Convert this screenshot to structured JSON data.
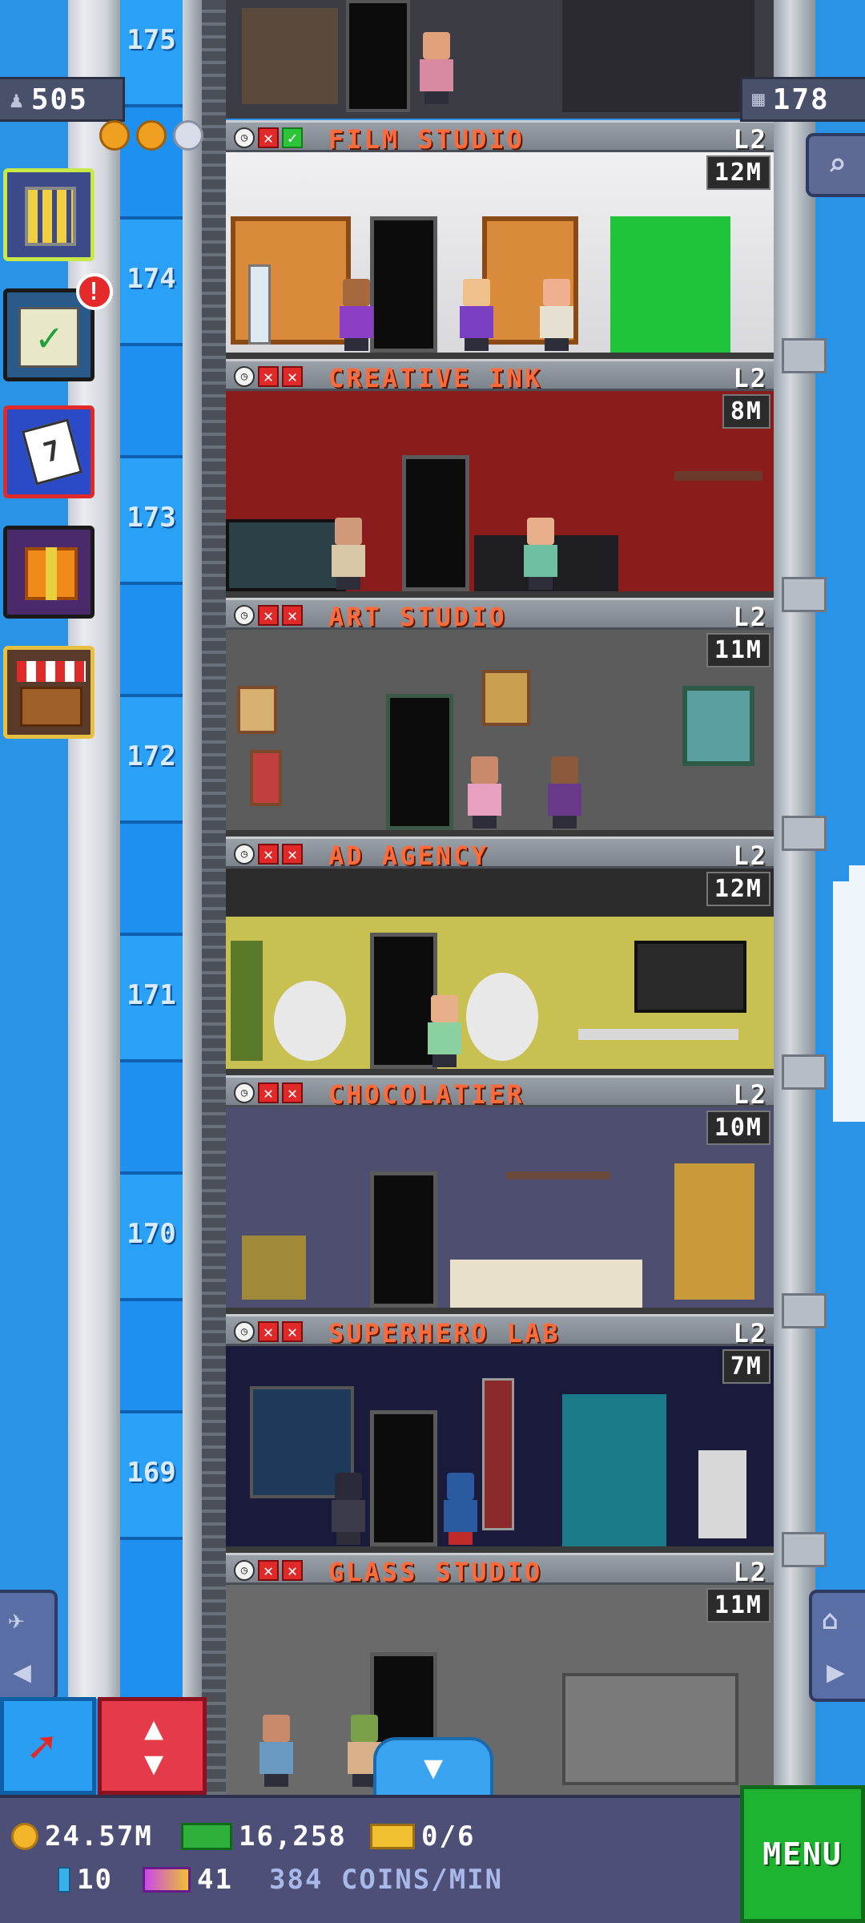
{
  "top": {
    "population": "505",
    "floor_count": "178",
    "top_floor_number": "175"
  },
  "shaft": {
    "floor_numbers": [
      "174",
      "173",
      "172",
      "171",
      "170",
      "169"
    ]
  },
  "floors": [
    {
      "name": "FILM STUDIO",
      "level": "L2",
      "time": "12M",
      "icons": [
        "clock-icon",
        "x-icon",
        "check-icon"
      ]
    },
    {
      "name": "CREATIVE INK",
      "level": "L2",
      "time": "8M",
      "icons": [
        "clock-icon",
        "x-icon",
        "x-icon"
      ]
    },
    {
      "name": "ART STUDIO",
      "level": "L2",
      "time": "11M",
      "icons": [
        "clock-icon",
        "x-icon",
        "x-icon"
      ]
    },
    {
      "name": "AD AGENCY",
      "level": "L2",
      "time": "12M",
      "icons": [
        "clock-icon",
        "x-icon",
        "x-icon"
      ]
    },
    {
      "name": "CHOCOLATIER",
      "level": "L2",
      "time": "10M",
      "icons": [
        "clock-icon",
        "x-icon",
        "x-icon"
      ]
    },
    {
      "name": "SUPERHERO LAB",
      "level": "L2",
      "time": "7M",
      "icons": [
        "clock-icon",
        "x-icon",
        "x-icon"
      ]
    },
    {
      "name": "GLASS STUDIO",
      "level": "L2",
      "time": "11M",
      "icons": [
        "clock-icon",
        "x-icon",
        "x-icon"
      ]
    }
  ],
  "side_menu": {
    "badge": "!",
    "calendar_day": "7"
  },
  "bottom": {
    "coins": "24.57M",
    "bux": "16,258",
    "tickets": "0/6",
    "bitizen_vip": "10",
    "golden_tickets": "41",
    "rate": "384 COINS/MIN",
    "menu_label": "MENU"
  },
  "colors": {
    "sky": "#2a93e6",
    "shaft": "#1e90f0",
    "floor_name": "#ff6a3a",
    "menu": "#1fb332",
    "bottom_bar": "#4d4f77"
  }
}
